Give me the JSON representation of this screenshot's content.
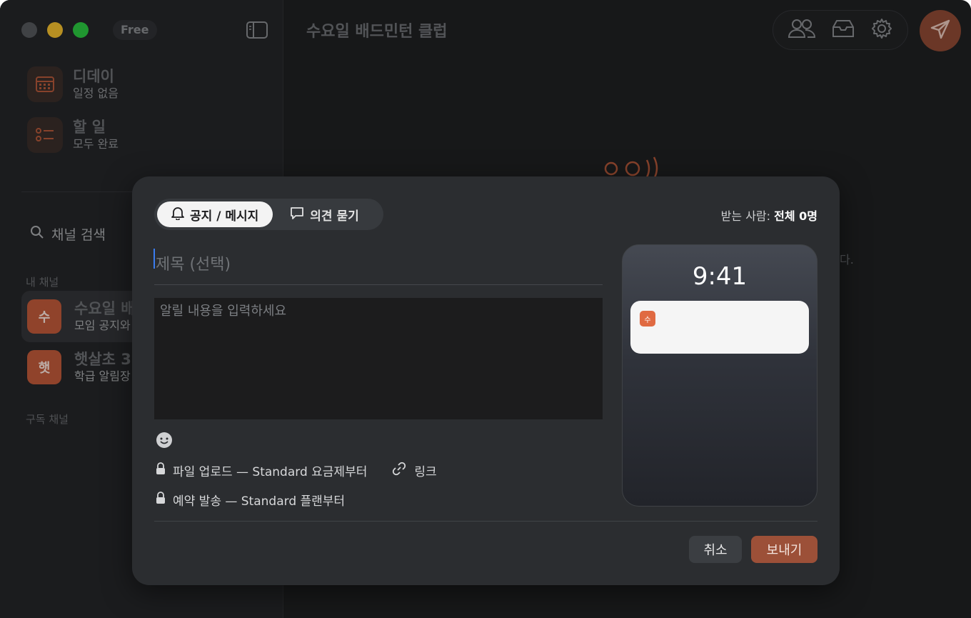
{
  "app": {
    "plan_badge": "Free"
  },
  "sidebar": {
    "dday": {
      "title": "디데이",
      "subtitle": "일정 없음"
    },
    "todo": {
      "title": "할 일",
      "subtitle": "모두 완료"
    },
    "search_label": "채널 검색",
    "my_channels_label": "내 채널",
    "channels": [
      {
        "avatar": "수",
        "title": "수요일 배",
        "subtitle": "모임 공지와"
      },
      {
        "avatar": "햇",
        "title": "햇살초 3",
        "subtitle": "학급 알림장"
      }
    ],
    "subscribed_label": "구독 채널"
  },
  "main": {
    "title": "수요일 배드민턴 클럽",
    "empty_tail": "다."
  },
  "dialog": {
    "tabs": [
      {
        "label": "공지 / 메시지"
      },
      {
        "label": "의견 묻기"
      }
    ],
    "recipients_label": "받는 사람:",
    "recipients_value": "전체 0명",
    "title_placeholder": "제목 (선택)",
    "body_placeholder": "알릴 내용을 입력하세요",
    "file_upload": "파일 업로드 — Standard 요금제부터",
    "link_label": "링크",
    "scheduled_send": "예약 발송 — Standard 플랜부터",
    "cancel_label": "취소",
    "send_label": "보내기"
  },
  "preview": {
    "time": "9:41",
    "notif_icon": "수"
  },
  "colors": {
    "accent": "#9c5038",
    "avatar": "#c15a3a",
    "caret": "#3a7df0"
  }
}
